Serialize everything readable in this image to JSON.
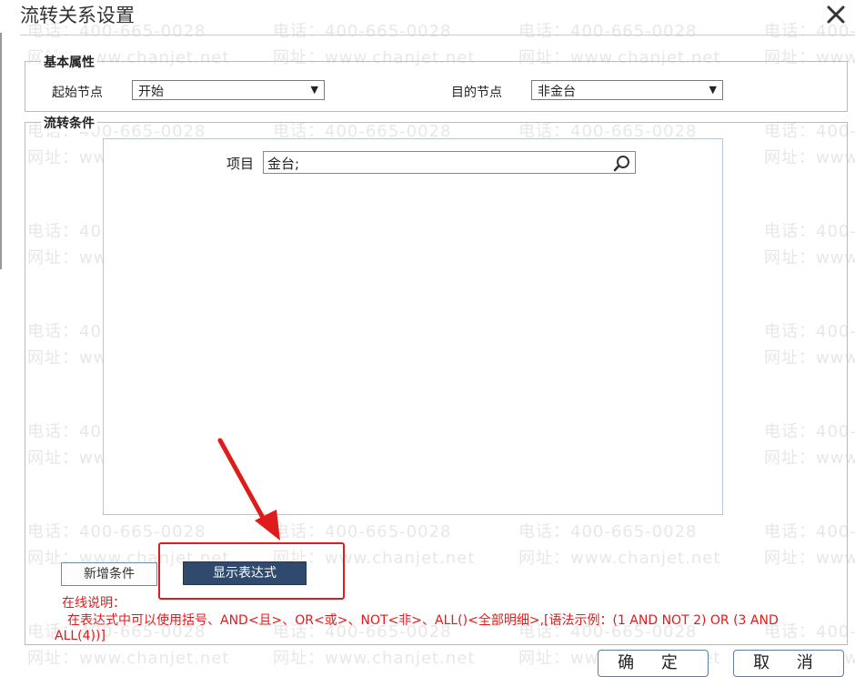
{
  "dialog": {
    "title": "流转关系设置"
  },
  "basic": {
    "group_label": "基本属性",
    "start_label": "起始节点",
    "start_value": "开始",
    "target_label": "目的节点",
    "target_value": "非金台"
  },
  "condition": {
    "group_label": "流转条件",
    "item_label": "项目",
    "item_value": "金台;"
  },
  "buttons": {
    "add_condition": "新增条件",
    "show_expression": "显示表达式",
    "ok": "确 定",
    "cancel": "取 消"
  },
  "help": {
    "title": "在线说明：",
    "text": "在表达式中可以使用括号、AND<且>、OR<或>、NOT<非>、ALL()<全部明细>,[语法示例：(1 AND NOT 2) OR (3 AND ALL(4))]"
  },
  "watermark": {
    "phone": "电话：400-665-0028",
    "site": "网址：www.chanjet.net"
  },
  "colors": {
    "accent_red": "#e01b1b",
    "button_dark": "#2f4a6c"
  }
}
